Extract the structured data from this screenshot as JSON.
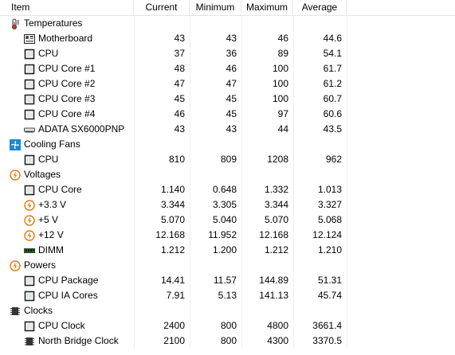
{
  "columns": [
    "Item",
    "Current",
    "Minimum",
    "Maximum",
    "Average"
  ],
  "groups": [
    {
      "label": "Temperatures",
      "icon": "thermometer-icon",
      "sensors": [
        {
          "label": "Motherboard",
          "icon": "motherboard-icon",
          "current": "43",
          "min": "43",
          "max": "46",
          "avg": "44.6"
        },
        {
          "label": "CPU",
          "icon": "cpu-chip-icon",
          "current": "37",
          "min": "36",
          "max": "89",
          "avg": "54.1"
        },
        {
          "label": "CPU Core #1",
          "icon": "cpu-chip-icon",
          "current": "48",
          "min": "46",
          "max": "100",
          "avg": "61.7"
        },
        {
          "label": "CPU Core #2",
          "icon": "cpu-chip-icon",
          "current": "47",
          "min": "47",
          "max": "100",
          "avg": "61.2"
        },
        {
          "label": "CPU Core #3",
          "icon": "cpu-chip-icon",
          "current": "45",
          "min": "45",
          "max": "100",
          "avg": "60.7"
        },
        {
          "label": "CPU Core #4",
          "icon": "cpu-chip-icon",
          "current": "46",
          "min": "45",
          "max": "97",
          "avg": "60.6"
        },
        {
          "label": "ADATA SX6000PNP",
          "icon": "ssd-drive-icon",
          "current": "43",
          "min": "43",
          "max": "44",
          "avg": "43.5"
        }
      ]
    },
    {
      "label": "Cooling Fans",
      "icon": "fan-icon",
      "sensors": [
        {
          "label": "CPU",
          "icon": "cpu-chip-icon",
          "current": "810",
          "min": "809",
          "max": "1208",
          "avg": "962"
        }
      ]
    },
    {
      "label": "Voltages",
      "icon": "voltage-icon",
      "sensors": [
        {
          "label": "CPU Core",
          "icon": "cpu-chip-icon",
          "current": "1.140",
          "min": "0.648",
          "max": "1.332",
          "avg": "1.013"
        },
        {
          "label": "+3.3 V",
          "icon": "voltage-icon",
          "current": "3.344",
          "min": "3.305",
          "max": "3.344",
          "avg": "3.327"
        },
        {
          "label": "+5 V",
          "icon": "voltage-icon",
          "current": "5.070",
          "min": "5.040",
          "max": "5.070",
          "avg": "5.068"
        },
        {
          "label": "+12 V",
          "icon": "voltage-icon",
          "current": "12.168",
          "min": "11.952",
          "max": "12.168",
          "avg": "12.124"
        },
        {
          "label": "DIMM",
          "icon": "ram-icon",
          "current": "1.212",
          "min": "1.200",
          "max": "1.212",
          "avg": "1.210"
        }
      ]
    },
    {
      "label": "Powers",
      "icon": "voltage-icon",
      "sensors": [
        {
          "label": "CPU Package",
          "icon": "cpu-chip-icon",
          "current": "14.41",
          "min": "11.57",
          "max": "144.89",
          "avg": "51.31"
        },
        {
          "label": "CPU IA Cores",
          "icon": "cpu-chip-icon",
          "current": "7.91",
          "min": "5.13",
          "max": "141.13",
          "avg": "45.74"
        }
      ]
    },
    {
      "label": "Clocks",
      "icon": "clock-chip-icon",
      "sensors": [
        {
          "label": "CPU Clock",
          "icon": "cpu-chip-icon",
          "current": "2400",
          "min": "800",
          "max": "4800",
          "avg": "3661.4"
        },
        {
          "label": "North Bridge Clock",
          "icon": "clock-chip-icon",
          "current": "2100",
          "min": "800",
          "max": "4300",
          "avg": "3370.5"
        }
      ]
    }
  ]
}
